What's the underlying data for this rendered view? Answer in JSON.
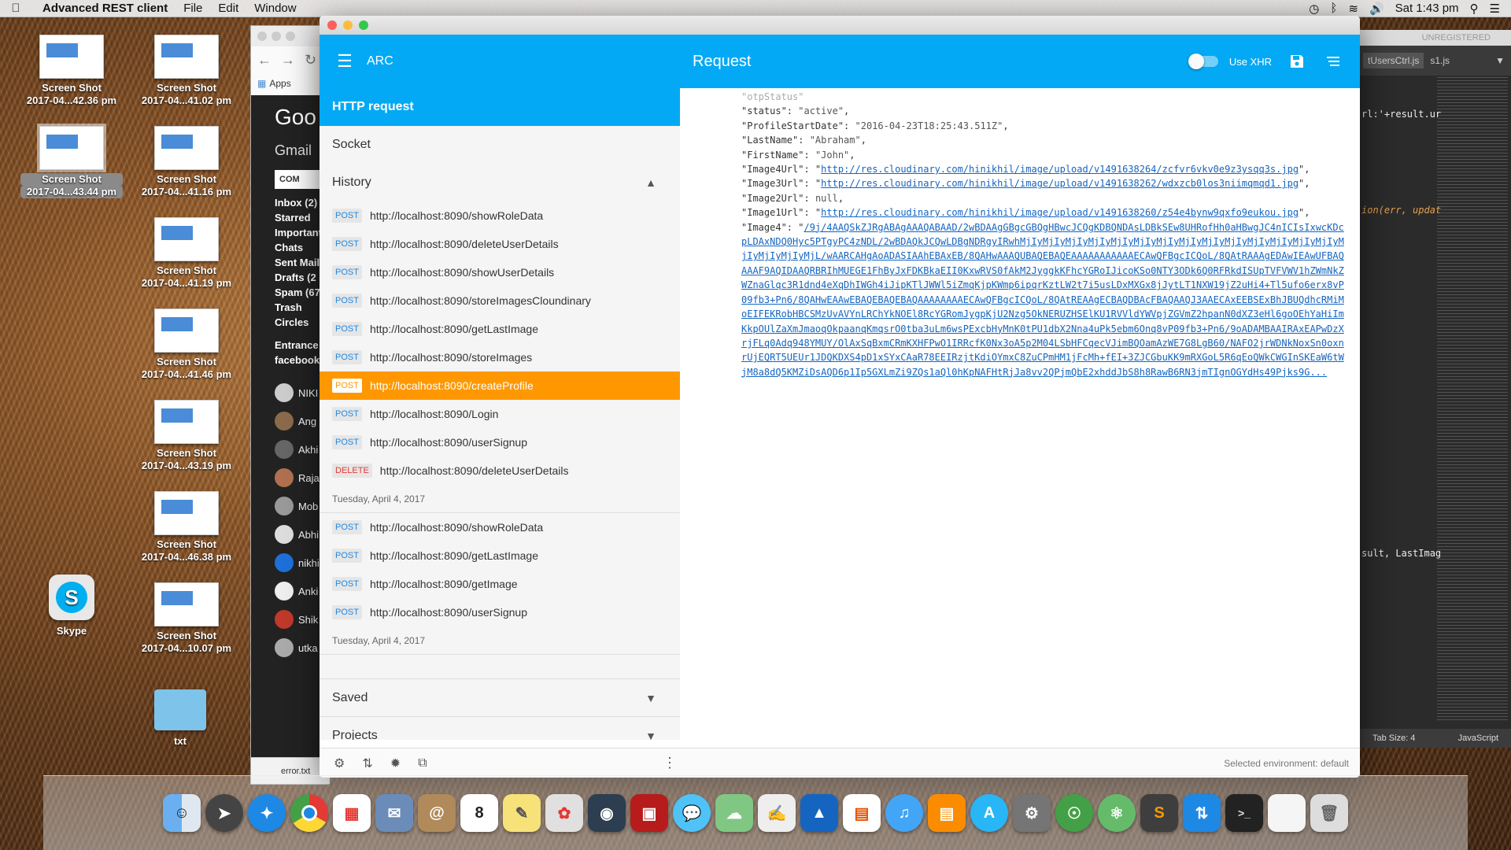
{
  "menubar": {
    "app": "Advanced REST client",
    "items": [
      "File",
      "Edit",
      "Window"
    ],
    "clock": "Sat 1:43 pm"
  },
  "desktop_icons": [
    {
      "title": "Screen Shot",
      "sub": "2017-04...42.36 pm"
    },
    {
      "title": "Screen Shot",
      "sub": "2017-04...41.02 pm"
    },
    {
      "title": "Screen Shot",
      "sub": "2017-04...43.44 pm"
    },
    {
      "title": "Screen Shot",
      "sub": "2017-04...41.16 pm"
    },
    {
      "title": "Screen Shot",
      "sub": "2017-04...41.19 pm"
    },
    {
      "title": "Screen Shot",
      "sub": "2017-04...41.46 pm"
    },
    {
      "title": "Screen Shot",
      "sub": "2017-04...43.19 pm"
    },
    {
      "title": "Screen Shot",
      "sub": "2017-04...46.38 pm"
    },
    {
      "title": "Screen Shot",
      "sub": "2017-04...10.07 pm"
    },
    {
      "title": "Skype"
    },
    {
      "title": "txt"
    }
  ],
  "chrome": {
    "apps": "Apps",
    "brand": "Goo",
    "gmail": "Gmail",
    "compose": "COM",
    "folders": [
      "Inbox (2)",
      "Starred",
      "Important",
      "Chats",
      "Sent Mail",
      "Drafts (2",
      "Spam (67",
      "Trash",
      "Circles",
      "Entrance",
      "facebook"
    ],
    "contacts": [
      "NIKI",
      "Ang",
      "Akhi",
      "Raja",
      "Mob",
      "Abhi",
      "nikhi",
      "Anki",
      "Shik",
      "utka"
    ],
    "download": "error.txt"
  },
  "editor": {
    "unregistered": "UNREGISTERED",
    "tabs": [
      "tUsersCtrl.js",
      "s1.js"
    ],
    "code_lines": [
      "rl:'+result.ur",
      "ion(err, updat",
      "sult, LastImag"
    ],
    "tab_size": "Tab Size: 4",
    "language": "JavaScript"
  },
  "arc": {
    "app_name": "ARC",
    "title": "Request",
    "use_xhr": "Use XHR",
    "nav": {
      "http": "HTTP request",
      "socket": "Socket",
      "history": "History",
      "saved": "Saved",
      "projects": "Projects"
    },
    "history": [
      {
        "method": "POST",
        "url": "http://localhost:8090/showRoleData"
      },
      {
        "method": "POST",
        "url": "http://localhost:8090/deleteUserDetails"
      },
      {
        "method": "POST",
        "url": "http://localhost:8090/showUserDetails"
      },
      {
        "method": "POST",
        "url": "http://localhost:8090/storeImagesCloundinary"
      },
      {
        "method": "POST",
        "url": "http://localhost:8090/getLastImage"
      },
      {
        "method": "POST",
        "url": "http://localhost:8090/storeImages"
      },
      {
        "method": "POST",
        "url": "http://localhost:8090/createProfile",
        "selected": true
      },
      {
        "method": "POST",
        "url": "http://localhost:8090/Login"
      },
      {
        "method": "POST",
        "url": "http://localhost:8090/userSignup"
      },
      {
        "method": "DELETE",
        "url": "http://localhost:8090/deleteUserDetails"
      }
    ],
    "date1": "Tuesday, April 4, 2017",
    "history2": [
      {
        "method": "POST",
        "url": "http://localhost:8090/showRoleData"
      },
      {
        "method": "POST",
        "url": "http://localhost:8090/getLastImage"
      },
      {
        "method": "POST",
        "url": "http://localhost:8090/getImage"
      },
      {
        "method": "POST",
        "url": "http://localhost:8090/userSignup"
      }
    ],
    "date2": "Tuesday, April 4, 2017",
    "environment": "Selected environment: default",
    "response": {
      "partial_top": "\"otpStatus\"",
      "status_key": "\"status\"",
      "status_val": "\"active\"",
      "psd_key": "\"ProfileStartDate\"",
      "psd_val": "\"2016-04-23T18:25:43.511Z\"",
      "ln_key": "\"LastName\"",
      "ln_val": "\"Abraham\"",
      "fn_key": "\"FirstName\"",
      "fn_val": "\"John\"",
      "img4url_key": "\"Image4Url\"",
      "img4url_val": "http://res.cloudinary.com/hinikhil/image/upload/v1491638264/zcfvr6vkv0e9z3ysqq3s.jpg",
      "img3url_key": "\"Image3Url\"",
      "img3url_val": "http://res.cloudinary.com/hinikhil/image/upload/v1491638262/wdxzcb0los3niimqmqd1.jpg",
      "img2url_key": "\"Image2Url\"",
      "img2url_val": "null",
      "img1url_key": "\"Image1Url\"",
      "img1url_val": "http://res.cloudinary.com/hinikhil/image/upload/v1491638260/z54e4bynw9qxfo9eukou.jpg",
      "img4_key": "\"Image4\"",
      "img4_val": "/9j/4AAQSkZJRgABAgAAAQABAAD/2wBDAAgGBgcGBQgHBwcJCQgKDBQNDAsLDBkSEw8UHRofHh0aHBwgJC4nICIsIxwcKDcpLDAxNDQ0Hyc5PTgyPC4zNDL/2wBDAQkJCQwLDBgNDRgyIRwhMjIyMjIyMjIyMjIyMjIyMjIyMjIyMjIyMjIyMjIyMjIyMjIyMjIyMjIyMjIyMjIyMjIyMjL/wAARCAHgAoADASIAAhEBAxEB/8QAHwAAAQUBAQEBAQEAAAAAAAAAAAECAwQFBgcICQoL/8QAtRAAAgEDAwIEAwUFBAQAAAF9AQIDAAQRBRIhMUEGE1FhByJxFDKBkaEII0KxwRVS0fAkM2JyggkKFhcYGRoIJicoKSo0NTY3ODk6Q0RFRkdISUpTVFVWV1hZWmNkZWZnaGlqc3R1dnd4eXqDhIWGh4iJipKTlJWWl5iZmqKjpKWmp6ipqrKztLW2t7i5usLDxMXGx8jJytLT1NXW19jZ2uHi4+Tl5ufo6erx8vP09fb3+Pn6/8QAHwEAAwEBAQEBAQEBAQAAAAAAAAECAwQFBgcICQoL/8QAtREAAgECBAQDBAcFBAQAAQJ3AAECAxEEBSExBhJBUQdhcRMiMoEIFEKRobHBCSMzUvAVYnLRChYkNOEl8RcYGRomJygpKjU2Nzg5OkNERUZHSElKU1RVVldYWVpjZGVmZ2hpanN0dXZ3eHl6goOEhYaHiImKkpOUlZaXmJmaoqOkpaanqKmqsrO0tba3uLm6wsPExcbHyMnK0tPU1dbX2Nna4uPk5ebm6Onq8vP09fb3+Pn6/9oADAMBAAIRAxEAPwDzXrjFLq0Adq948YMUY/OlAxSqBxmCRmKXHFPwO1IRRcfK0Nx3oA5p2M04LSbHFCqecVJimBQOamAzWE7G8LgB60/NAFO2jrWDNkNoxSn0oxnrUjEQRT5UEUr1JDQKDXS4pD1xSYxCAaR78EEIRzjtKdiOYmxC8ZuCPmHM1jFcMh+fEI+3ZJCGbuKK9mRXGoL5R6qEoQWkCWGInSKEaW6tWjM8a8dQ5KMZiDsAQD6p1Ip5GXLmZi9ZQs1aQl0hKpNAFHtRjJa8vv2QPjmQbE2xhddJbS8h8RawB6RN3jmTIgnOGYdHs49Pjks9G..."
    }
  },
  "dock": {
    "items": [
      "finder",
      "launchpad",
      "safari",
      "chrome",
      "launcher",
      "mail-stamp",
      "contacts",
      "calendar",
      "notes",
      "photos",
      "facetime",
      "photo-booth",
      "messages",
      "preview",
      "textedit",
      "keynote",
      "ibooks-stats",
      "itunes",
      "ibooks",
      "app-store",
      "system-preferences",
      "sourcetree",
      "atom",
      "sublime-text",
      "filezilla",
      "terminal",
      "documents",
      "trash"
    ]
  }
}
